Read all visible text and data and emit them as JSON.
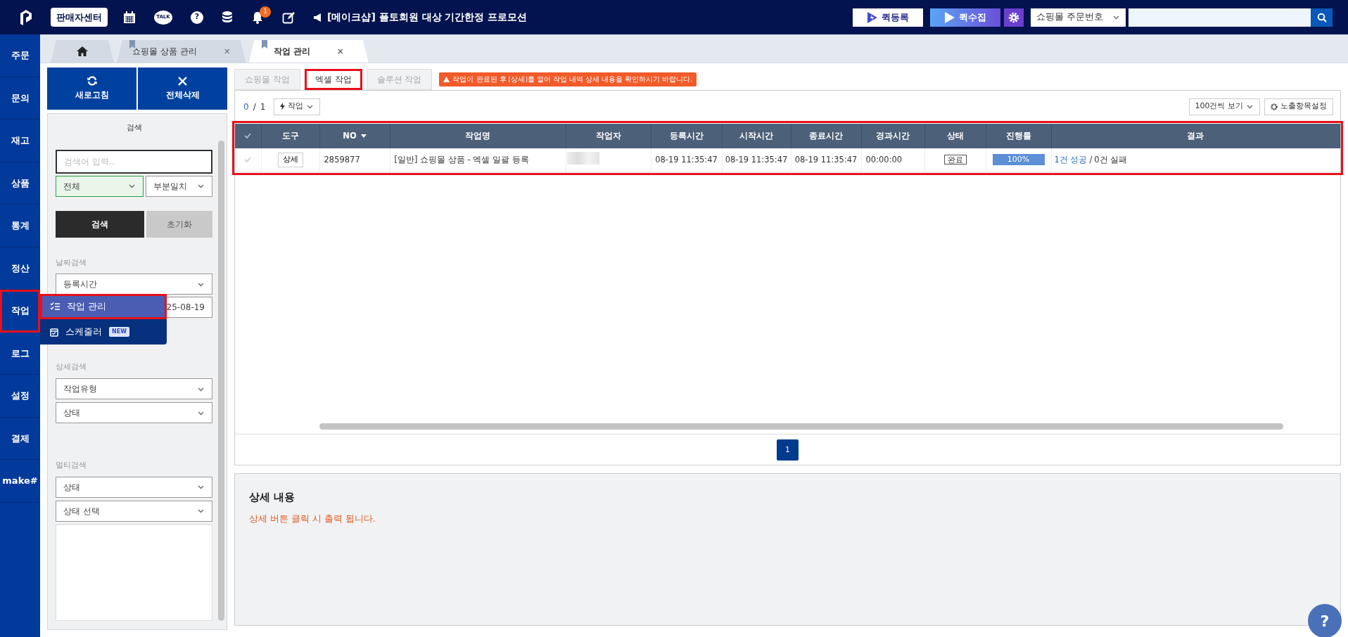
{
  "topbar": {
    "seller_center": "판매자센터",
    "talk_text": "TALK",
    "help_glyph": "?",
    "notification_count": "1",
    "notice": "[메이크샵] 플토회원 대상 기간한정 프로모션",
    "quick_register": "퀵등록",
    "quick_collect": "퀵수집",
    "search_select": "쇼핑몰 주문번호"
  },
  "rail": [
    {
      "label": "주문",
      "annotated": false
    },
    {
      "label": "문의",
      "annotated": false
    },
    {
      "label": "재고",
      "annotated": false
    },
    {
      "label": "상품",
      "annotated": false
    },
    {
      "label": "통계",
      "annotated": false
    },
    {
      "label": "정산",
      "annotated": false
    },
    {
      "label": "작업",
      "annotated": true,
      "menu": [
        {
          "label": "작업 관리",
          "kind": "list",
          "selected": true,
          "annotated": true
        },
        {
          "label": "스케줄러",
          "badge": "NEW",
          "kind": "calendar",
          "selected": false,
          "annotated": false
        }
      ]
    },
    {
      "label": "로그",
      "annotated": false
    },
    {
      "label": "설정",
      "annotated": false
    },
    {
      "label": "결제",
      "annotated": false
    },
    {
      "label": "make#",
      "annotated": false
    }
  ],
  "page_tabs": [
    {
      "kind": "home",
      "selected": false
    },
    {
      "kind": "page",
      "label": "쇼핑몰 상품 관리",
      "close": "×",
      "selected": false
    },
    {
      "kind": "page",
      "label": "작업 관리",
      "close": "×",
      "selected": true
    }
  ],
  "filter": {
    "refresh": "새로고침",
    "clear_all": "전체삭제",
    "title": "검색",
    "search_placeholder": "검색어 입력..",
    "scope": "전체",
    "match": "부분일치",
    "search_button": "검색",
    "reset_button": "초기화",
    "date_label": "날짜검색",
    "date_field": "등록시간",
    "date_value": "25-08-19",
    "detail_label": "상세검색",
    "detail_selects": [
      "작업유형",
      "상태"
    ],
    "multi_label": "멀티검색",
    "multi_selects": [
      "상태",
      "상태 선택"
    ]
  },
  "work_tabs": [
    {
      "label": "쇼핑몰 작업",
      "selected": false,
      "annotated": false
    },
    {
      "label": "엑셀 작업",
      "selected": true,
      "annotated": true
    },
    {
      "label": "솔루션 작업",
      "selected": false,
      "annotated": false
    }
  ],
  "warning": "작업이 완료된 후 [상세]를 열어 작업 내역 상세 내용을 확인하시기 바랍니다.",
  "toolbar": {
    "selected_count": "0",
    "separator": "/",
    "total": "1",
    "action_menu": "작업",
    "page_size": "100건씩 보기",
    "columns_setting": "노출항목설정"
  },
  "table": {
    "annotated": true,
    "columns": [
      {
        "label": "도구",
        "sorted": false
      },
      {
        "label": "NO",
        "sorted": true
      },
      {
        "label": "작업명",
        "sorted": false
      },
      {
        "label": "작업자",
        "sorted": false
      },
      {
        "label": "등록시간",
        "sorted": false
      },
      {
        "label": "시작시간",
        "sorted": false
      },
      {
        "label": "종료시간",
        "sorted": false
      },
      {
        "label": "경과시간",
        "sorted": false
      },
      {
        "label": "상태",
        "sorted": false
      },
      {
        "label": "진행률",
        "sorted": false
      },
      {
        "label": "결과",
        "sorted": false
      }
    ],
    "rows": [
      {
        "checked": false,
        "tool": "상세",
        "no": "2859877",
        "name": "[일반] 쇼핑몰 상품 - 엑셀 일괄 등록",
        "registered": "08-19 11:35:47",
        "started": "08-19 11:35:47",
        "ended": "08-19 11:35:47",
        "elapsed": "00:00:00",
        "status": "완료",
        "level": 1,
        "progress": "100%",
        "success": "1건 성공",
        "result_separator": "/",
        "failure": "0건 실패"
      }
    ]
  },
  "pagination": [
    {
      "label": "1",
      "selected": true
    }
  ],
  "detail": {
    "title": "상세 내용",
    "message": "상세 버튼 클릭 시 출력 됩니다."
  },
  "help_button": "?"
}
